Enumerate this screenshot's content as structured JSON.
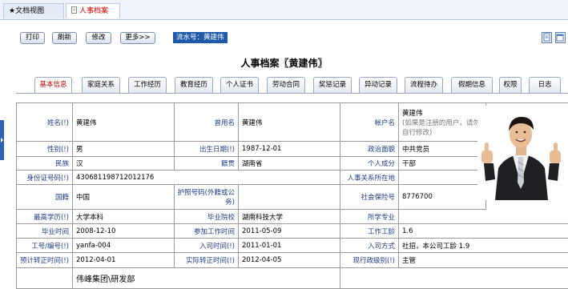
{
  "top_tabs": [
    "★文档视图",
    "人事档案"
  ],
  "toolbar": {
    "buttons": [
      "打印",
      "刷新",
      "修改",
      "更多>>"
    ],
    "serial": "流水号：黄建伟"
  },
  "title": "人事档案〖黄建伟〗",
  "tabs": [
    "基本信息",
    "家庭关系",
    "工作经历",
    "教育经历",
    "个人证书",
    "劳动合同",
    "奖惩记录",
    "异动记录",
    "流程待办",
    "假期信息",
    "权限",
    "日志"
  ],
  "fields": {
    "name_label": "姓名(!)",
    "name_value": "黄建伟",
    "formername_label": "曾用名",
    "formername_value": "黄建伟",
    "account_label": "帐户名",
    "account_value": "黄建伟",
    "account_hint": "(如果是注册的用户，请勿自行修改)",
    "gender_label": "性别(!)",
    "gender_value": "男",
    "birth_label": "出生日期(!)",
    "birth_value": "1987-12-01",
    "politics_label": "政治面貌",
    "politics_value": "中共党员",
    "ethnic_label": "民族",
    "ethnic_value": "汉",
    "origin_label": "籍贯",
    "origin_value": "湖南省",
    "status_label": "个人成分",
    "status_value": "干部",
    "idcard_label": "身份证号码(!)",
    "idcard_value": "430681198712012176",
    "hr_label": "人事关系所在地",
    "hr_value": "",
    "nation_label": "国籍",
    "nation_value": "中国",
    "passport_label": "护照号码(外籍或公务)",
    "passport_value": "",
    "social_label": "社会保险号",
    "social_value": "8776700",
    "edu_label": "最高学历(!)",
    "edu_value": "大学本科",
    "school_label": "毕业院校",
    "school_value": "湖南科技大学",
    "major_label": "所学专业",
    "major_value": "",
    "grad_label": "毕业时间",
    "grad_value": "2008-12-10",
    "workstart_label": "参加工作时间",
    "workstart_value": "2011-05-09",
    "seniority_label": "工作工龄",
    "seniority_value": "1.6",
    "empno_label": "工号/编号(!)",
    "empno_value": "yanfa-004",
    "join_label": "入司时间(!)",
    "join_value": "2011-01-01",
    "joinway_label": "入司方式",
    "joinway_value": "社招，本公司工龄 1.9",
    "plannedreg_label": "预计转正时间(!)",
    "plannedreg_value": "2012-04-01",
    "actualreg_label": "实际转正时间(!)",
    "actualreg_value": "2012-04-05",
    "rank_label": "现行政级别(!)",
    "rank_value": "主管",
    "dept_value": "伟峰集团\\研发部"
  },
  "colors": {
    "accent": "#1e5aa8",
    "label": "#1f3c8c",
    "active_tab": "#c00000"
  }
}
